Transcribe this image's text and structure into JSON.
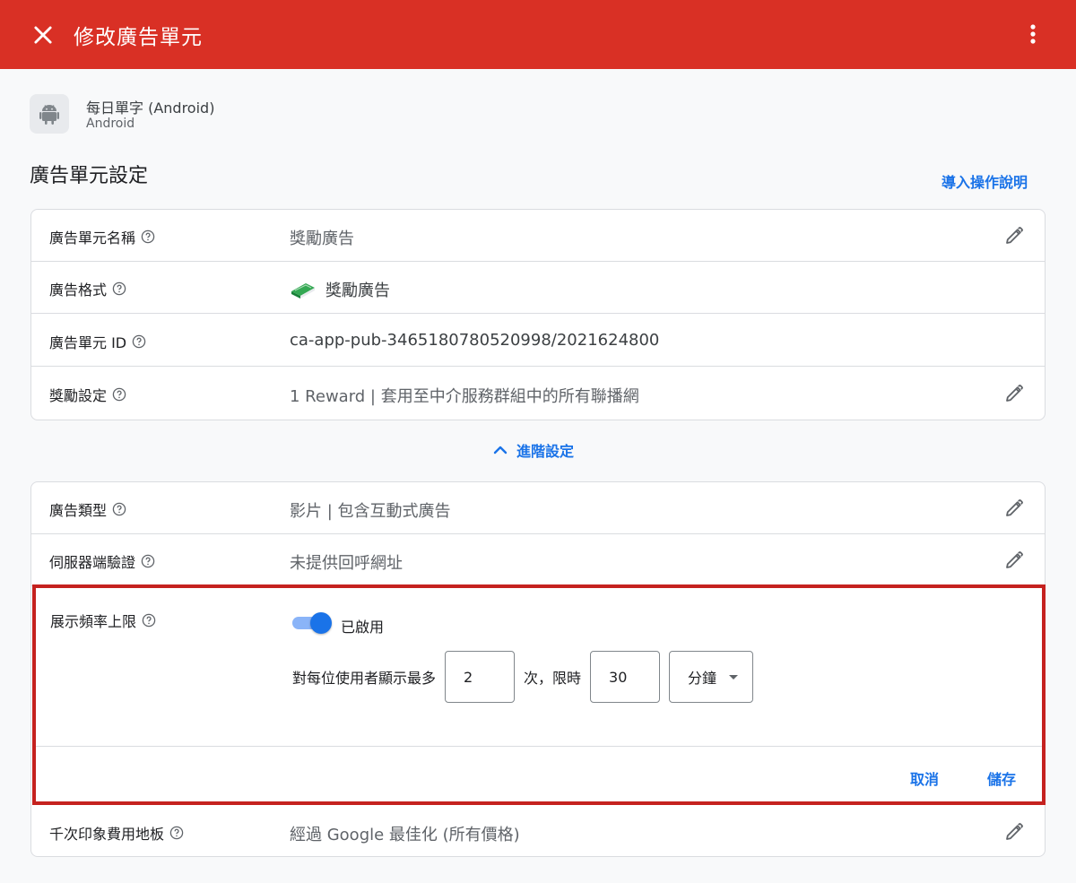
{
  "colors": {
    "header": "#d93025",
    "accent": "#1a73e8",
    "highlight": "#c5221f"
  },
  "header": {
    "title": "修改廣告單元",
    "close_icon": "close-icon",
    "menu_icon": "more-vert-icon"
  },
  "app": {
    "name": "每日單字 (Android)",
    "platform": "Android",
    "icon": "android-icon"
  },
  "section": {
    "title": "廣告單元設定",
    "guide_link": "導入操作說明"
  },
  "basic_rows": [
    {
      "label": "廣告單元名稱",
      "value": "獎勵廣告",
      "editable": true
    },
    {
      "label": "廣告格式",
      "value": "獎勵廣告",
      "icon": "reward-book-icon",
      "editable": false
    },
    {
      "label": "廣告單元 ID",
      "value": "ca-app-pub-3465180780520998/2021624800",
      "editable": false
    },
    {
      "label": "獎勵設定",
      "value": "1 Reward | 套用至中介服務群組中的所有聯播網",
      "editable": true
    }
  ],
  "advanced": {
    "label": "進階設定",
    "expanded": true
  },
  "advanced_rows": [
    {
      "label": "廣告類型",
      "value": "影片 | 包含互動式廣告",
      "editable": true
    },
    {
      "label": "伺服器端驗證",
      "value": "未提供回呼網址",
      "editable": true
    }
  ],
  "frequency_cap": {
    "label": "展示頻率上限",
    "enabled": true,
    "toggle_text": "已啟用",
    "prefix": "對每位使用者顯示最多",
    "count": "2",
    "middle": "次，限時",
    "duration": "30",
    "unit": "分鐘",
    "cancel": "取消",
    "save": "儲存"
  },
  "floor_row": {
    "label": "千次印象費用地板",
    "value": "經過 Google 最佳化 (所有價格)",
    "editable": true
  }
}
